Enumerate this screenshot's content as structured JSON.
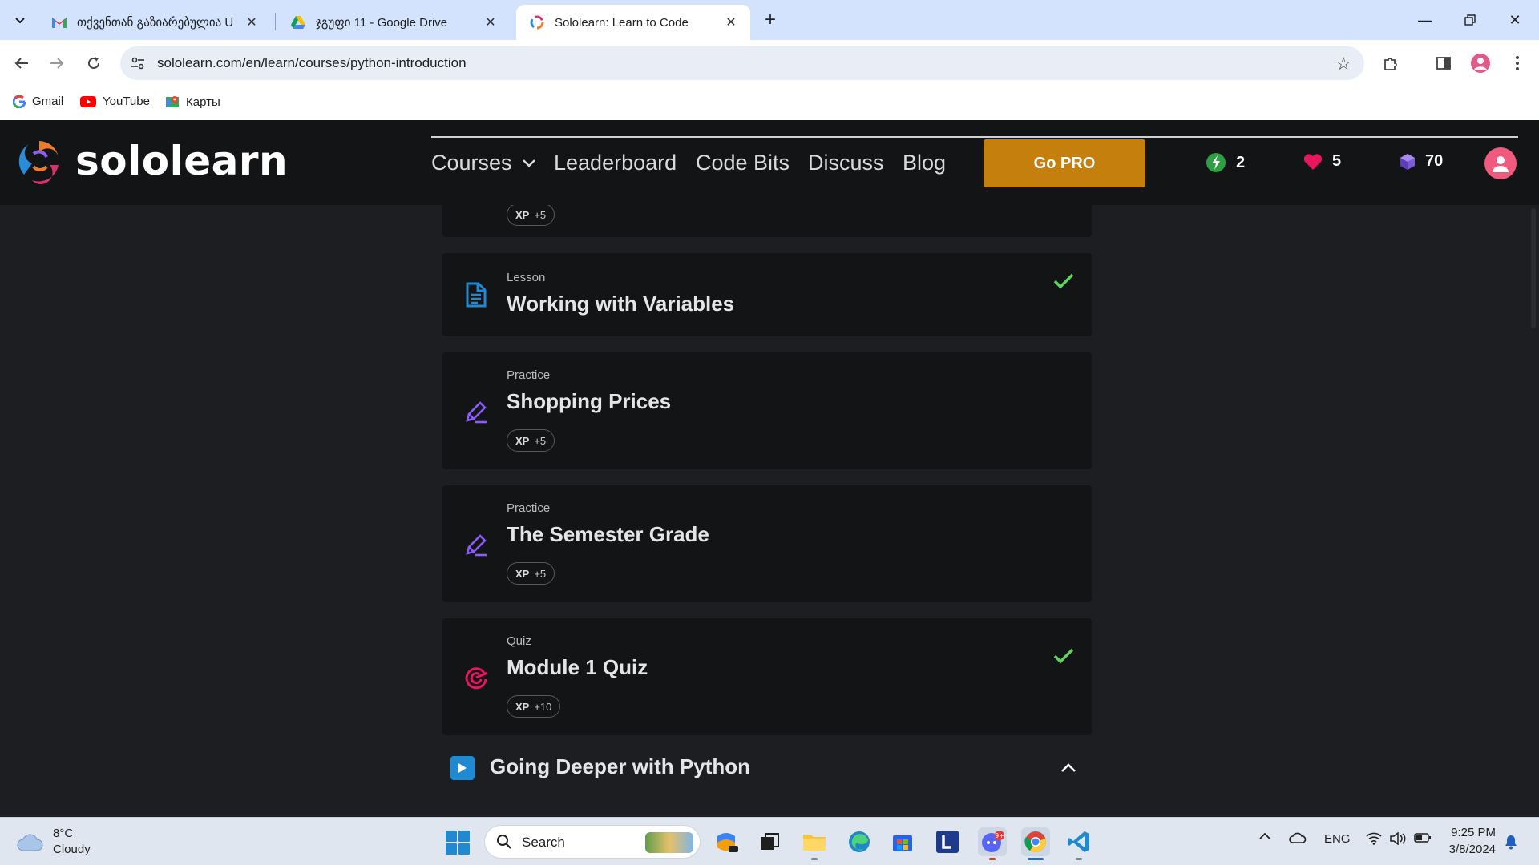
{
  "browser": {
    "tabs": [
      {
        "title": "თქვენთან გაზიარებულია U",
        "icon": "gmail-icon"
      },
      {
        "title": "ჯგუფი 11 - Google Drive",
        "icon": "google-drive-icon"
      },
      {
        "title": "Sololearn: Learn to Code",
        "icon": "sololearn-icon",
        "active": true
      }
    ],
    "url": "sololearn.com/en/learn/courses/python-introduction",
    "bookmarks": [
      {
        "label": "Gmail"
      },
      {
        "label": "YouTube"
      },
      {
        "label": "Карты"
      }
    ]
  },
  "header": {
    "logo_text": "sololearn",
    "nav": {
      "courses": "Courses",
      "leaderboard": "Leaderboard",
      "code_bits": "Code Bits",
      "discuss": "Discuss",
      "blog": "Blog"
    },
    "go_pro": "Go PRO",
    "stats": {
      "streak": "2",
      "hearts": "5",
      "gems": "70"
    }
  },
  "lessons": {
    "partial_xp": {
      "xp_label": "XP",
      "xp_value": "+5"
    },
    "items": [
      {
        "type": "Lesson",
        "title": "Working with Variables",
        "completed": true
      },
      {
        "type": "Practice",
        "title": "Shopping Prices",
        "xp_label": "XP",
        "xp_value": "+5"
      },
      {
        "type": "Practice",
        "title": "The Semester Grade",
        "xp_label": "XP",
        "xp_value": "+5"
      },
      {
        "type": "Quiz",
        "title": "Module 1 Quiz",
        "xp_label": "XP",
        "xp_value": "+10",
        "completed": true
      }
    ]
  },
  "section": {
    "title": "Going Deeper with Python"
  },
  "taskbar": {
    "weather": {
      "temp": "8°C",
      "condition": "Cloudy"
    },
    "search_placeholder": "Search",
    "language": "ENG",
    "time": "9:25 PM",
    "date": "3/8/2024",
    "discord_badge": "9+"
  },
  "colors": {
    "accent_pro": "#c47f0c",
    "check_green": "#5fd35f",
    "practice_purple": "#8b5cf6",
    "quiz_red": "#e8175d",
    "lesson_blue": "#1f8ad2"
  }
}
